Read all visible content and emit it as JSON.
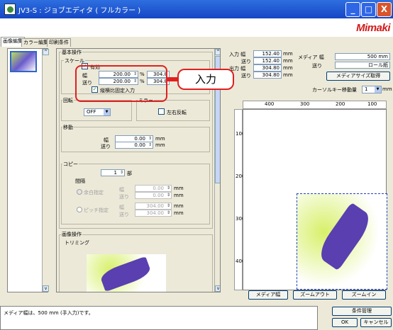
{
  "window": {
    "title": "JV3-S : ジョブエディタ ( フルカラー )",
    "logo": "Mimaki",
    "controls": {
      "min": "_",
      "max": "□",
      "close": "X"
    }
  },
  "tabs": [
    "画像編集",
    "カラー編集",
    "印刷条件"
  ],
  "panel": {
    "basic_ops": "基本操作",
    "scale": {
      "title": "スケール",
      "enabled_label": "有効",
      "width_label": "幅",
      "width_value": "200.00",
      "feed_label": "送り",
      "feed_value": "200.00",
      "unit": "%",
      "right_width": "304.8",
      "right_feed": "304.8",
      "fixed_ratio_label": "縦横比固定入力"
    },
    "rotate": {
      "title": "回転",
      "value": "OFF"
    },
    "mirror": {
      "title": "ミラー",
      "label": "左右反転"
    },
    "move": {
      "title": "移動",
      "width_label": "幅",
      "width_value": "0.00",
      "feed_label": "送り",
      "feed_value": "0.00",
      "unit": "mm"
    },
    "copy": {
      "title": "コピー",
      "count": "1",
      "count_unit": "部",
      "interval": "間隔",
      "margin_label": "余白指定",
      "pitch_label": "ピッチ指定",
      "w_label": "幅",
      "f_label": "送り",
      "m_w": "0.00",
      "m_f": "0.00",
      "p_w": "304.00",
      "p_f": "304.00",
      "unit": "mm"
    },
    "image_ops": "画像操作",
    "trimming": "トリミング"
  },
  "info": {
    "in_width_label": "入力 幅",
    "in_width": "152.40",
    "in_feed_label": "送り",
    "in_feed": "152.40",
    "out_width_label": "出力 幅",
    "out_width": "304.80",
    "out_feed_label": "送り",
    "out_feed": "304.80",
    "unit": "mm",
    "media_label": "メディア 幅",
    "media_width": "500 mm",
    "feed_label": "送り",
    "media_feed": "ロール紙",
    "media_btn": "メディアサイズ取得",
    "cursor_label": "カーソルキー移動量",
    "cursor_value": "1",
    "cursor_unit": "mm"
  },
  "ruler": {
    "top": [
      "400",
      "300",
      "200",
      "100"
    ],
    "left": [
      "100",
      "200",
      "300",
      "400"
    ]
  },
  "bottom_buttons": {
    "media_width": "メディア幅",
    "zoom_out": "ズームアウト",
    "zoom_in": "ズームイン"
  },
  "status": {
    "message": "メディア幅は、500 mm (手入力)です。",
    "cond": "条件管理",
    "ok": "OK",
    "cancel": "キャンセル"
  },
  "callout": "入力"
}
